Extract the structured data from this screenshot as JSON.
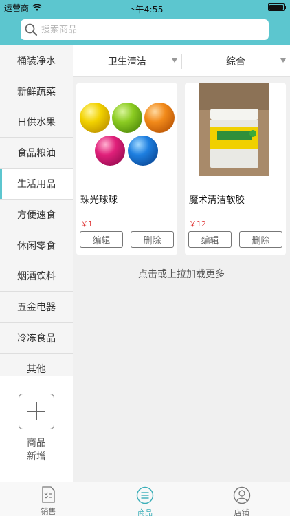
{
  "status_bar": {
    "carrier": "运营商",
    "time": "下午4:55"
  },
  "search": {
    "placeholder": "搜索商品"
  },
  "categories": [
    {
      "label": "桶装净水",
      "active": false
    },
    {
      "label": "新鲜蔬菜",
      "active": false
    },
    {
      "label": "日供水果",
      "active": false
    },
    {
      "label": "食品粮油",
      "active": false
    },
    {
      "label": "生活用品",
      "active": true
    },
    {
      "label": "方便速食",
      "active": false
    },
    {
      "label": "休闲零食",
      "active": false
    },
    {
      "label": "烟酒饮料",
      "active": false
    },
    {
      "label": "五金电器",
      "active": false
    },
    {
      "label": "冷冻食品",
      "active": false
    },
    {
      "label": "其他",
      "active": false
    }
  ],
  "add_product": {
    "label_line1": "商品",
    "label_line2": "新增"
  },
  "filters": {
    "category": "卫生清洁",
    "sort": "综合"
  },
  "products": [
    {
      "name": "珠光球球",
      "price": "￥1",
      "image": "colorful-balls"
    },
    {
      "name": "魔术清洁软胶",
      "price": "￥12",
      "image": "cleaning-gel-jar"
    }
  ],
  "card_actions": {
    "edit": "编辑",
    "delete": "删除"
  },
  "load_more": "点击或上拉加载更多",
  "tabbar": [
    {
      "label": "销售",
      "icon": "clipboard-list-icon",
      "active": false
    },
    {
      "label": "商品",
      "icon": "list-circle-icon",
      "active": true
    },
    {
      "label": "店铺",
      "icon": "user-circle-icon",
      "active": false
    }
  ],
  "colors": {
    "accent": "#5cc6cf",
    "price": "#e03b3b",
    "active_tab": "#3aaeb8"
  }
}
